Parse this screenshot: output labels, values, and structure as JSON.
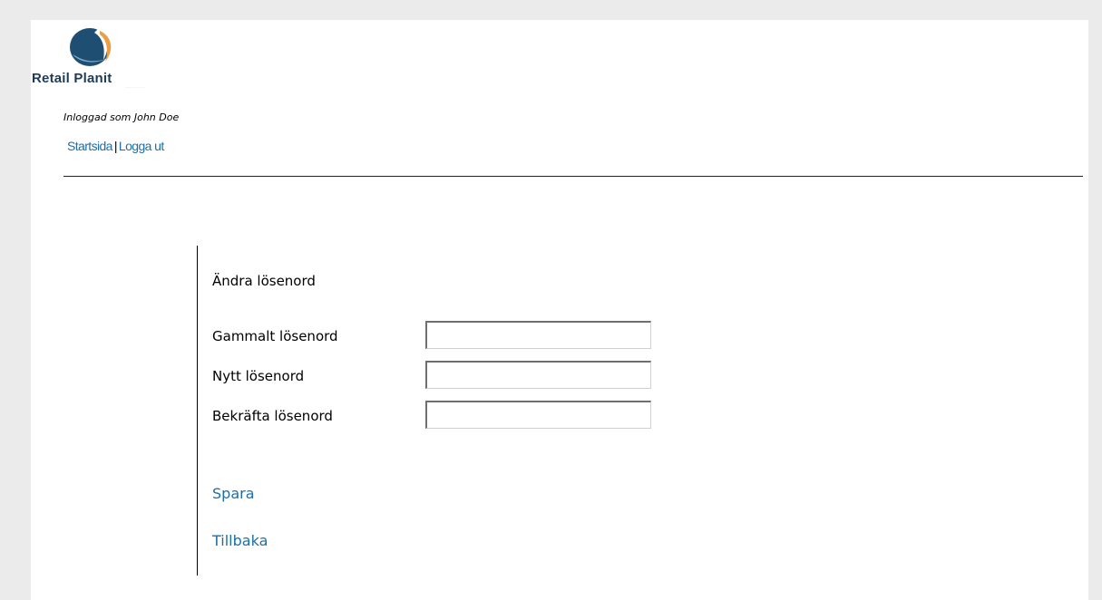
{
  "brand": {
    "name": "Retail Planit",
    "accent_color": "#1c6fa8",
    "logo_colors": [
      "#1f4e73",
      "#e8a046"
    ]
  },
  "header": {
    "logged_in_text": "Inloggad som John Doe",
    "links": {
      "home": "Startsida",
      "separator": "|",
      "logout": "Logga ut"
    }
  },
  "form": {
    "title": "Ändra lösenord",
    "fields": [
      {
        "label": "Gammalt lösenord",
        "value": "",
        "placeholder": ""
      },
      {
        "label": "Nytt lösenord",
        "value": "",
        "placeholder": ""
      },
      {
        "label": "Bekräfta lösenord",
        "value": "",
        "placeholder": ""
      }
    ],
    "actions": {
      "save": "Spara",
      "back": "Tillbaka"
    }
  }
}
